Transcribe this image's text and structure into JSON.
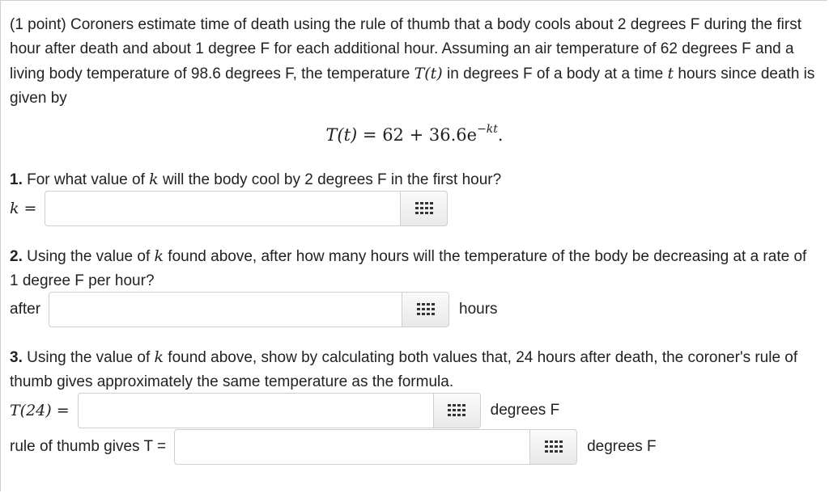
{
  "intro": {
    "part1": "(1 point) Coroners estimate time of death using the rule of thumb that a body cools about 2 degrees F during the first hour after death and about 1 degree F for each additional hour. Assuming an air temperature of 62 degrees F and a living body temperature of 98.6 degrees F, the temperature ",
    "Tt": "T(t)",
    "part2": " in degrees F of a body at a time ",
    "t": "t",
    "part3": " hours since death is given by"
  },
  "formula": {
    "lhs": "T(t)",
    "rhs": " = 62 + 36.6e",
    "exp": "−kt",
    "end": "."
  },
  "q1": {
    "num": "1.",
    "text_a": " For what value of ",
    "k": "k",
    "text_b": " will the body cool by 2 degrees F in the first hour?",
    "label": "k =",
    "value": ""
  },
  "q2": {
    "num": "2.",
    "text_a": " Using the value of ",
    "k": "k",
    "text_b": " found above, after how many hours will the temperature of the body be decreasing at a rate of 1 degree F per hour?",
    "label": "after",
    "unit": "hours",
    "value": ""
  },
  "q3": {
    "num": "3.",
    "text_a": " Using the value of ",
    "k": "k",
    "text_b": " found above, show by calculating both values that, 24 hours after death, the coroner's rule of thumb gives approximately the same temperature as the formula.",
    "label1": "T(24) =",
    "unit1": "degrees F",
    "label2": "rule of thumb gives T =",
    "unit2": "degrees F",
    "value1": "",
    "value2": ""
  },
  "icons": {
    "equation_editor": "equation-editor-grid-icon"
  }
}
